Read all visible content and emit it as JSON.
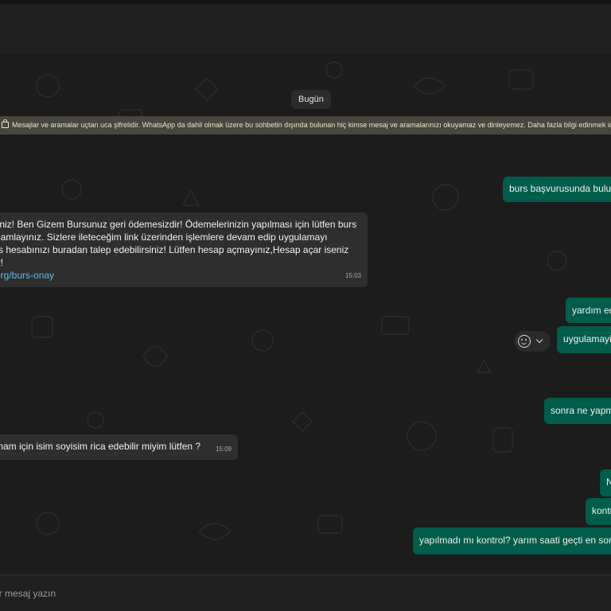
{
  "chat": {
    "date_chip": "Bugün",
    "encryption_notice": "Mesajlar ve aramalar uçtan uca şifrelidir. WhatsApp da dahil olmak üzere bu sohbetin dışında bulunan hiç kimse mesaj ve aramalarınızı okuyamaz ve dinleyemez. Daha fazla bilgi edinmek için seç",
    "messages": {
      "out_1": "burs başvurusunda bulun",
      "in_1": {
        "lines": [
          "liniz! Ben Gizem Bursunuz geri ödemesizdir! Ödemelerinizin yapılması için lütfen burs",
          "namlayınız. Sizlere ileteceğim link üzerinden işlemlere devam edip uygulamayı",
          "rs hesabınızı buradan talep edebilirsiniz! Lütfen hesap açmayınız,Hesap açar iseniz",
          "ir!"
        ],
        "link": "org/burs-onay",
        "time": "15:03"
      },
      "out_2": "yardım ed",
      "out_3": "uygulamayi",
      "out_4": "sonra ne yapm",
      "in_2": {
        "text": "mam için isim soyisim rica edebilir miyim lütfen ?",
        "time": "15:09"
      },
      "out_5": "N",
      "out_6": "kontr",
      "out_7": "yapılmadı mı kontrol? yarım saati geçti en son"
    }
  },
  "compose": {
    "placeholder": "Bir mesaj yazın"
  },
  "icons": {
    "reaction": "smiley-icon",
    "menu": "chevron-down-icon",
    "lock": "lock-icon"
  },
  "colors": {
    "outgoing_bubble": "#005c4b",
    "incoming_bubble": "#2e2e2e",
    "banner": "#48473d",
    "link": "#53bdeb"
  }
}
